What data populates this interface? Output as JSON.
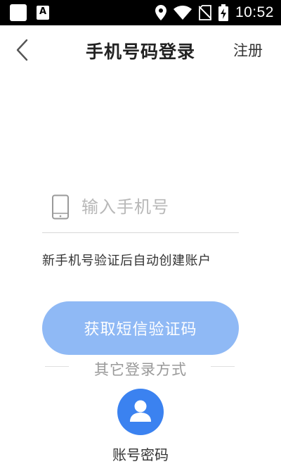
{
  "status_bar": {
    "time": "10:52",
    "icons": [
      "app-square-icon",
      "font-a-icon",
      "location-icon",
      "wifi-icon",
      "no-sim-icon",
      "battery-charging-icon"
    ]
  },
  "header": {
    "title": "手机号码登录",
    "register_label": "注册",
    "back_icon": "chevron-left-icon"
  },
  "form": {
    "phone_placeholder": "输入手机号",
    "phone_value": "",
    "phone_icon": "mobile-phone-icon",
    "hint": "新手机号验证后自动创建账户",
    "sms_button_label": "获取短信验证码",
    "sms_button_color": "#8fb9f5"
  },
  "other_login": {
    "label": "其它登录方式",
    "methods": [
      {
        "label": "账号密码",
        "icon": "user-icon",
        "color": "#3b82f0"
      }
    ]
  }
}
